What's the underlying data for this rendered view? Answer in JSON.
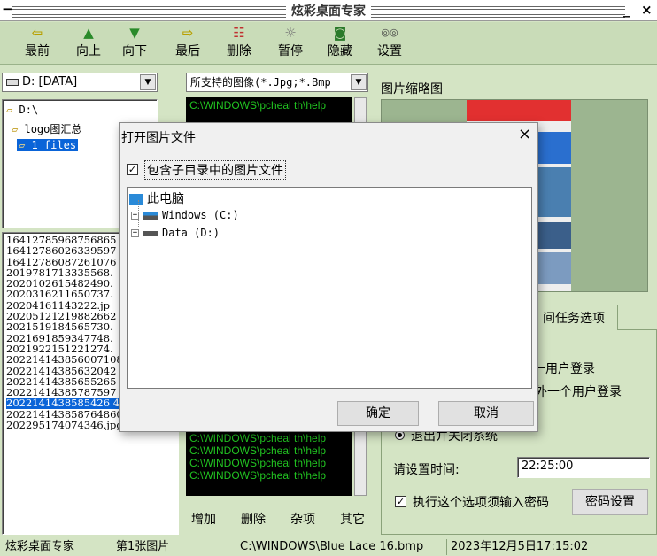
{
  "app": {
    "title": "炫彩桌面专家",
    "min_label": "_",
    "close_label": "×",
    "sysmenu_label": "−"
  },
  "toolbar": [
    {
      "id": "first",
      "label": "最前",
      "icon": "⇦",
      "color": "#b8a000"
    },
    {
      "id": "up",
      "label": "向上",
      "icon": "▲",
      "color": "#2a8a2a"
    },
    {
      "id": "down",
      "label": "向下",
      "icon": "▼",
      "color": "#2a8a2a"
    },
    {
      "id": "last",
      "label": "最后",
      "icon": "⇨",
      "color": "#b8a000"
    },
    {
      "id": "delete",
      "label": "删除",
      "icon": "☷",
      "color": "#c03030"
    },
    {
      "id": "pause",
      "label": "暂停",
      "icon": "☼",
      "color": "#777777"
    },
    {
      "id": "hide",
      "label": "隐藏",
      "icon": "◙",
      "color": "#2a7a2a"
    },
    {
      "id": "settings",
      "label": "设置",
      "icon": "◎◎",
      "color": "#444444"
    }
  ],
  "drive_combo": {
    "value": "D: [DATA]"
  },
  "filter_combo": {
    "value": "所支持的图像(*.Jpg;*.Bmp"
  },
  "thumb_label": "图片缩略图",
  "folder_tree": [
    "D:\\",
    "logo图汇总",
    "1_files"
  ],
  "files": [
    "16412785968756865",
    "16412786026339597",
    "16412786087261076",
    "2019781713335568.",
    "2020102615482490.",
    "2020316211650737.",
    "20204161143222.jp",
    "20205121219882662",
    "2021519184565730.",
    "2021691859347748.",
    "2021922151221274.",
    "202214143856007108",
    "20221414385632042",
    "20221414385655265",
    "20221414385787597",
    "2022141438585426 40.jpg",
    "202214143858764860.jpg",
    "202295174074346.jpg"
  ],
  "console_lines": [
    "C:\\WINDOWS\\pcheal th\\help"
  ],
  "console_bottom": [
    "C:\\WINDOWS\\pcheal th\\help",
    "C:\\WINDOWS\\pcheal th\\help",
    "C:\\WINDOWS\\pcheal th\\help",
    "C:\\WINDOWS\\pcheal th\\help"
  ],
  "list_buttons": [
    "增加",
    "删除",
    "杂项",
    "其它"
  ],
  "tab_label": "间任务选项",
  "options": {
    "line1": "一用户登录",
    "line2": "外一个用户登录",
    "radio_label": "退出并关闭系统",
    "time_label": "请设置时间:",
    "time_value": "22:25:00",
    "password_check": "执行这个选项须输入密码",
    "password_button": "密码设置"
  },
  "dialog": {
    "title": "打开图片文件",
    "close": "×",
    "include_subdirs": "包含子目录中的图片文件",
    "root": "此电脑",
    "drives": [
      "Windows (C:)",
      "Data (D:)"
    ],
    "ok": "确定",
    "cancel": "取消"
  },
  "status": {
    "app": "炫彩桌面专家",
    "index": "第1张图片",
    "path": "C:\\WINDOWS\\Blue Lace 16.bmp",
    "datetime": "2023年12月5日17:15:02"
  }
}
